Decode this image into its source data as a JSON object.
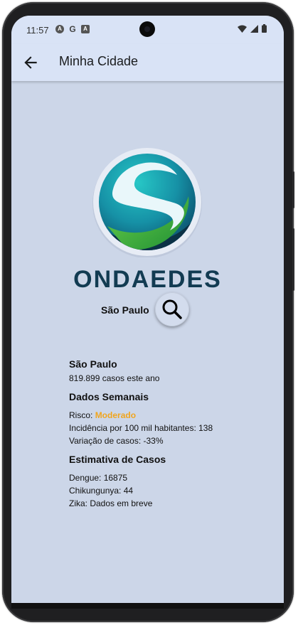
{
  "status_bar": {
    "time": "11:57",
    "notif_icons": [
      "A",
      "G",
      "A"
    ]
  },
  "app_bar": {
    "title": "Minha Cidade"
  },
  "logo": {
    "brand_text": "ONDAEDES",
    "colors": {
      "teal": "#1aa3ad",
      "dark": "#0b3146",
      "green": "#3db53d"
    }
  },
  "search": {
    "city": "São Paulo"
  },
  "summary": {
    "city": "São Paulo",
    "cases": "819.899 casos este ano"
  },
  "weekly": {
    "heading": "Dados Semanais",
    "risk_label": "Risco: ",
    "risk_value": "Moderado",
    "risk_color": "#f0a51e",
    "incidence": "Incidência por 100 mil habitantes: 138",
    "variation": "Variação de casos: -33%"
  },
  "estimates": {
    "heading": "Estimativa de Casos",
    "dengue": "Dengue: 16875",
    "chikungunya": "Chikungunya: 44",
    "zika": "Zika: Dados em breve"
  }
}
